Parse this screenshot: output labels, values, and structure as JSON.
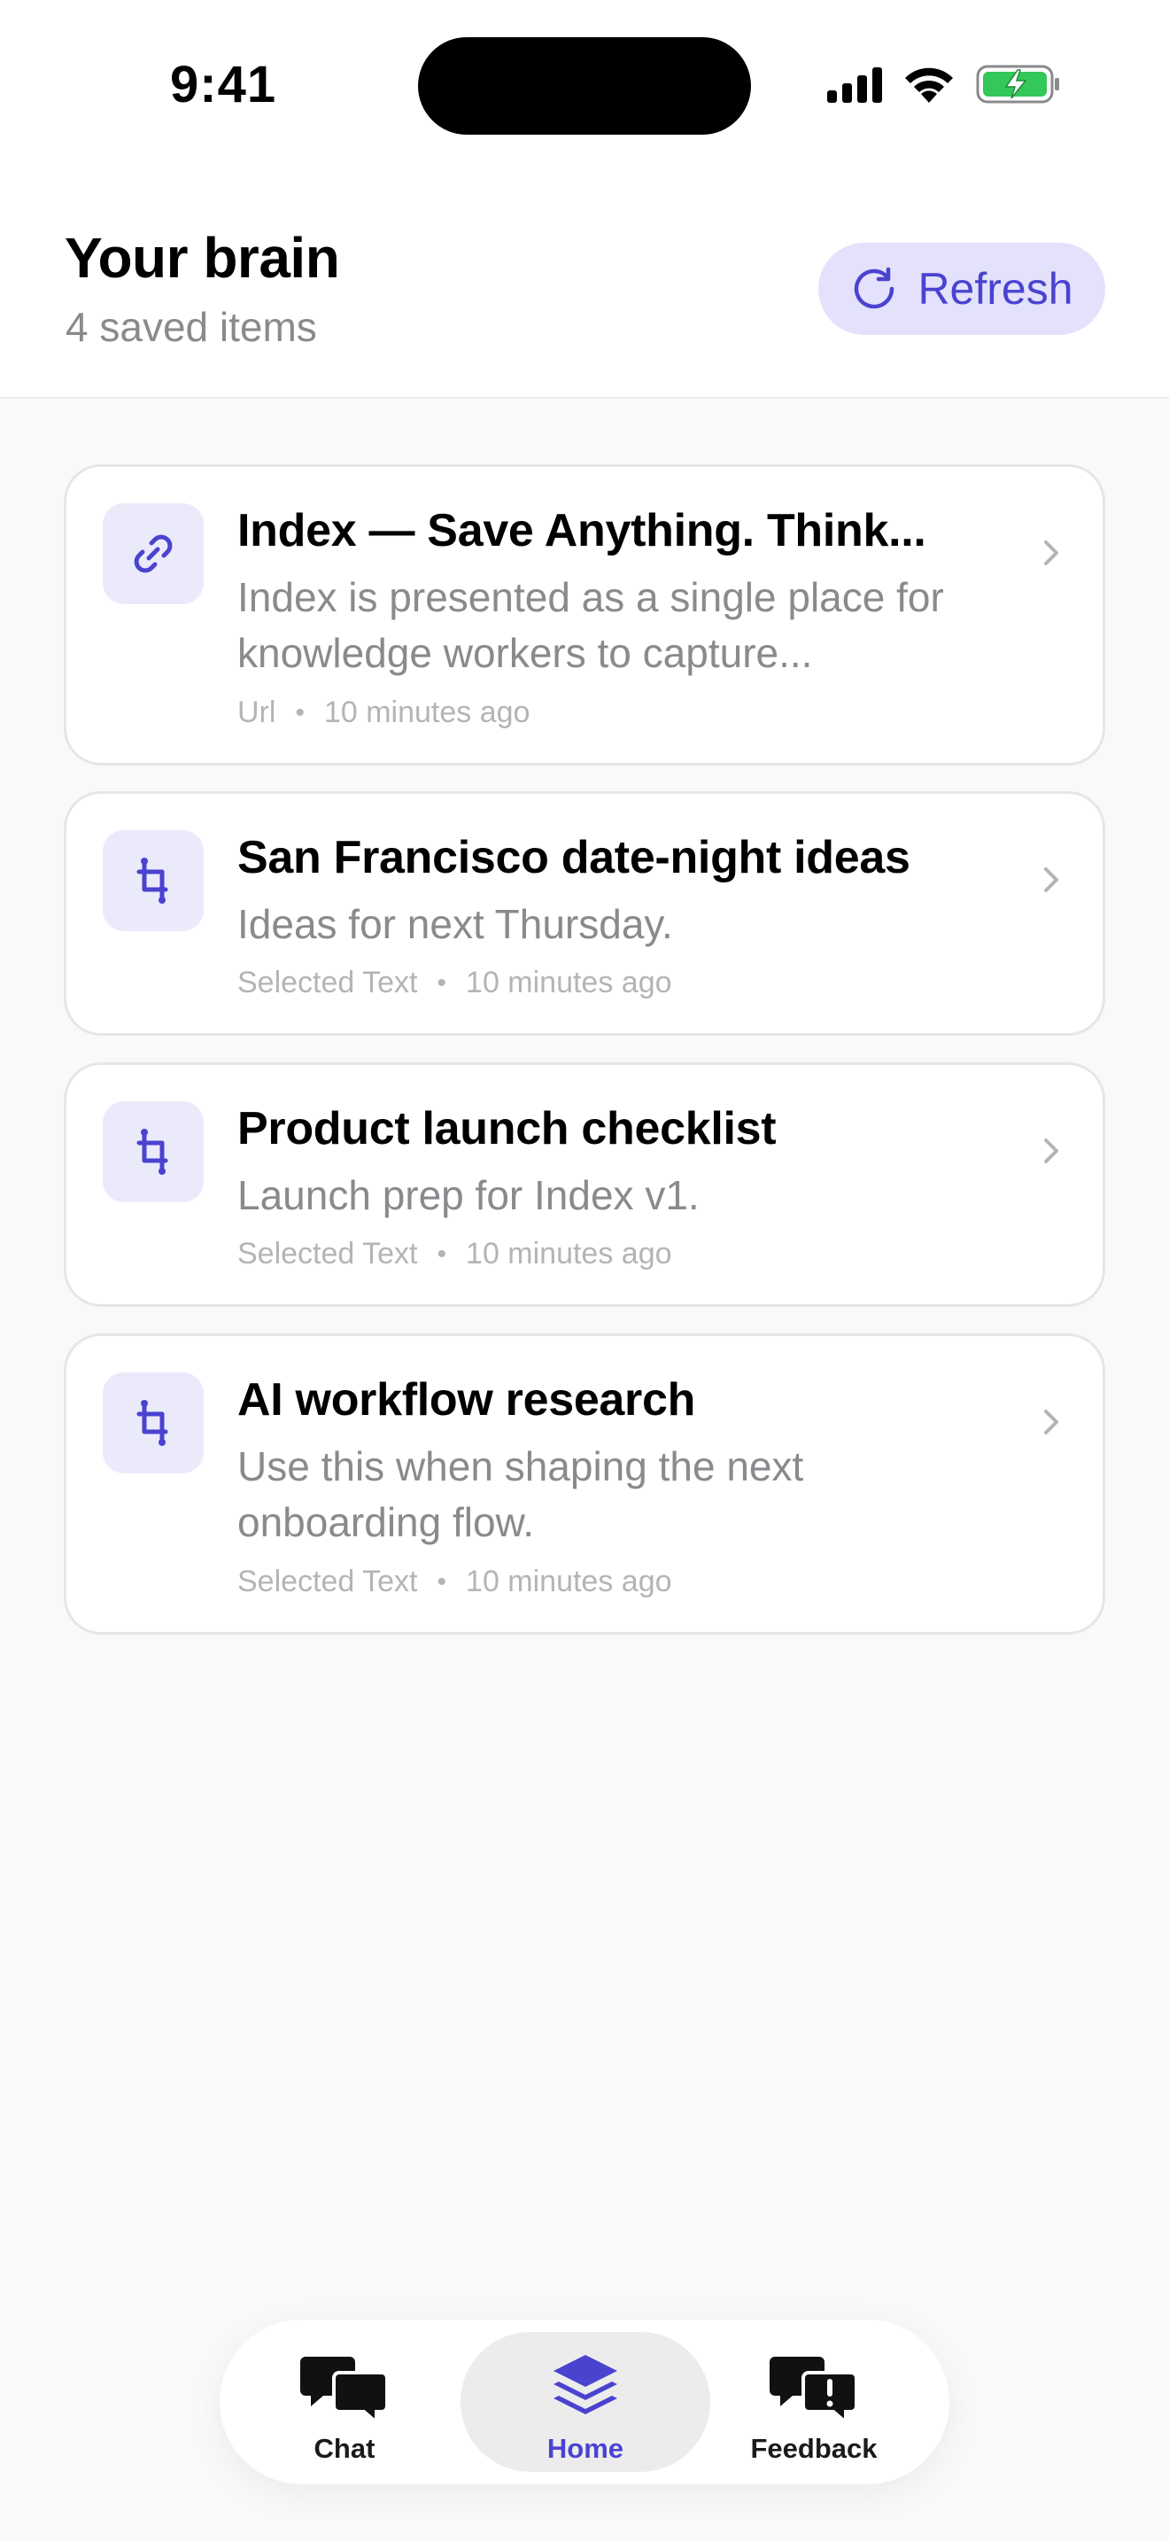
{
  "status_bar": {
    "time": "9:41"
  },
  "header": {
    "title": "Your brain",
    "subtitle": "4 saved items",
    "refresh_label": "Refresh"
  },
  "items": [
    {
      "title": "Index — Save Anything. Think...",
      "description": "Index is presented as a single place for knowledge workers to capture...",
      "type": "Url",
      "time": "10 minutes ago",
      "icon": "link-icon"
    },
    {
      "title": "San Francisco date-night ideas",
      "description": "Ideas for next Thursday.",
      "type": "Selected Text",
      "time": "10 minutes ago",
      "icon": "crop-icon"
    },
    {
      "title": "Product launch checklist",
      "description": "Launch prep for Index v1.",
      "type": "Selected Text",
      "time": "10 minutes ago",
      "icon": "crop-icon"
    },
    {
      "title": "AI workflow research",
      "description": "Use this when shaping the next onboarding flow.",
      "type": "Selected Text",
      "time": "10 minutes ago",
      "icon": "crop-icon"
    }
  ],
  "tabbar": {
    "tabs": [
      {
        "label": "Chat",
        "icon": "chat-bubbles-icon",
        "active": false
      },
      {
        "label": "Home",
        "icon": "layers-icon",
        "active": true
      },
      {
        "label": "Feedback",
        "icon": "feedback-bubbles-icon",
        "active": false
      }
    ]
  },
  "colors": {
    "accent": "#4a43d0",
    "accent_soft": "#e3e1fb",
    "battery": "#34c759"
  }
}
